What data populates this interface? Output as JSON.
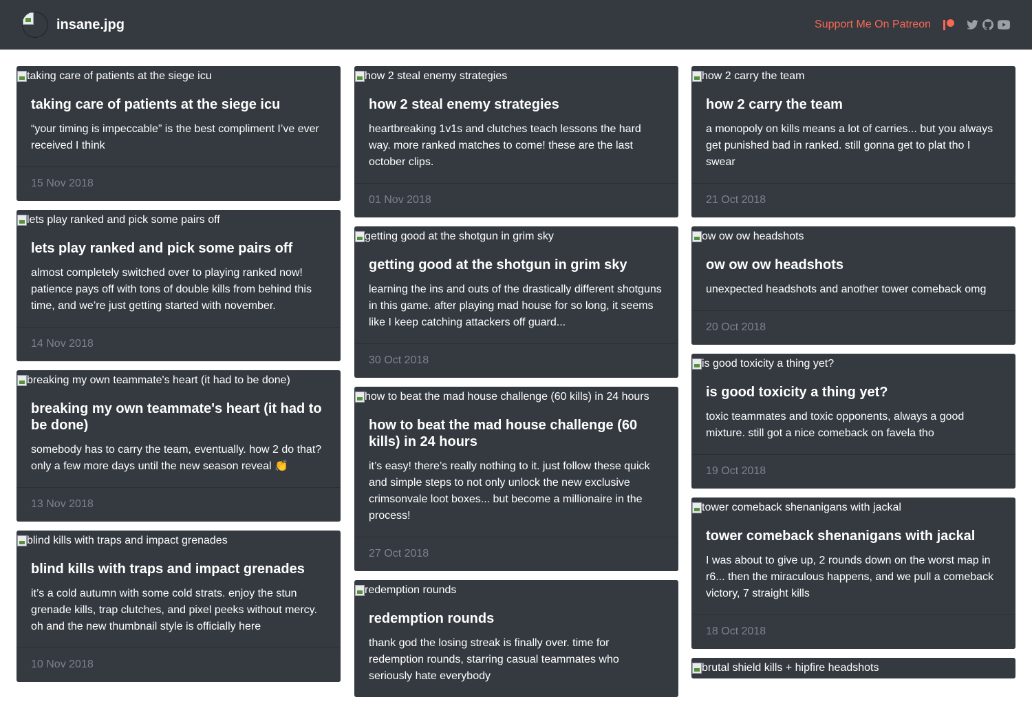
{
  "navbar": {
    "brand": "insane.jpg",
    "patreon_label": "Support Me On Patreon",
    "icons": [
      "patreon-icon",
      "twitter-icon",
      "github-icon",
      "youtube-icon"
    ],
    "colors": {
      "bg": "#343a40",
      "accent": "#f96854"
    }
  },
  "columns": [
    {
      "posts": [
        {
          "img_alt": "taking care of patients at the siege icu",
          "title": "taking care of patients at the siege icu",
          "text": "“your timing is impeccable” is the best compliment I’ve ever received I think",
          "date": "15 Nov 2018"
        },
        {
          "img_alt": "lets play ranked and pick some pairs off",
          "title": "lets play ranked and pick some pairs off",
          "text": "almost completely switched over to playing ranked now! patience pays off with tons of double kills from behind this time, and we’re just getting started with november.",
          "date": "14 Nov 2018"
        },
        {
          "img_alt": "breaking my own teammate's heart (it had to be done)",
          "title": "breaking my own teammate's heart (it had to be done)",
          "text": "somebody has to carry the team, eventually. how 2 do that? only a few more days until the new season reveal 👏",
          "date": "13 Nov 2018"
        },
        {
          "img_alt": "blind kills with traps and impact grenades",
          "title": "blind kills with traps and impact grenades",
          "text": "it’s a cold autumn with some cold strats. enjoy the stun grenade kills, trap clutches, and pixel peeks without mercy. oh and the new thumbnail style is officially here",
          "date": "10 Nov 2018"
        }
      ]
    },
    {
      "posts": [
        {
          "img_alt": "how 2 steal enemy strategies",
          "title": "how 2 steal enemy strategies",
          "text": "heartbreaking 1v1s and clutches teach lessons the hard way. more ranked matches to come! these are the last october clips.",
          "date": "01 Nov 2018"
        },
        {
          "img_alt": "getting good at the shotgun in grim sky",
          "title": "getting good at the shotgun in grim sky",
          "text": "learning the ins and outs of the drastically different shotguns in this game. after playing mad house for so long, it seems like I keep catching attackers off guard...",
          "date": "30 Oct 2018"
        },
        {
          "img_alt": "how to beat the mad house challenge (60 kills) in 24 hours",
          "title": "how to beat the mad house challenge (60 kills) in 24 hours",
          "text": "it’s easy! there’s really nothing to it. just follow these quick and simple steps to not only unlock the new exclusive crimsonvale loot boxes... but become a millionaire in the process!",
          "date": "27 Oct 2018"
        },
        {
          "img_alt": "redemption rounds",
          "title": "redemption rounds",
          "text": "thank god the losing streak is finally over. time for redemption rounds, starring casual teammates who seriously hate everybody",
          "date": ""
        }
      ]
    },
    {
      "posts": [
        {
          "img_alt": "how 2 carry the team",
          "title": "how 2 carry the team",
          "text": "a monopoly on kills means a lot of carries... but you always get punished bad in ranked. still gonna get to plat tho I swear",
          "date": "21 Oct 2018"
        },
        {
          "img_alt": "ow ow ow headshots",
          "title": "ow ow ow headshots",
          "text": "unexpected headshots and another tower comeback omg",
          "date": "20 Oct 2018"
        },
        {
          "img_alt": "is good toxicity a thing yet?",
          "title": "is good toxicity a thing yet?",
          "text": "toxic teammates and toxic opponents, always a good mixture. still got a nice comeback on favela tho",
          "date": "19 Oct 2018"
        },
        {
          "img_alt": "tower comeback shenanigans with jackal",
          "title": "tower comeback shenanigans with jackal",
          "text": "I was about to give up, 2 rounds down on the worst map in r6... then the miraculous happens, and we pull a comeback victory, 7 straight kills",
          "date": "18 Oct 2018"
        },
        {
          "img_alt": "brutal shield kills + hipfire headshots",
          "title": "",
          "text": "",
          "date": ""
        }
      ]
    }
  ]
}
